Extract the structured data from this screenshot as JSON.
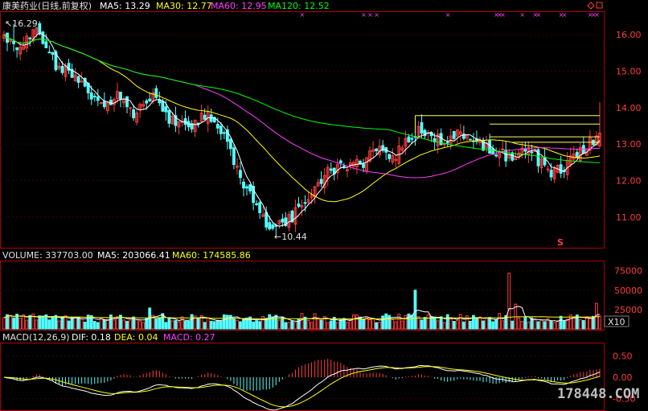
{
  "header": {
    "stock_title": "康美药业(日线,前复权)",
    "ma5_label": "MA5: 13.29",
    "ma30_label": "MA30: 12.77",
    "ma60_label": "MA60: 12.95",
    "ma120_label": "MA120: 12.52"
  },
  "volume_header": {
    "volume_label": "VOLUME: 337703.00",
    "ma5_label": "MA5: 203066.41",
    "ma60_label": "MA60: 174585.86"
  },
  "macd_header": {
    "name_label": "MACD(12,26,9)",
    "dif_label": "DIF: 0.18",
    "dea_label": "DEA: 0.04",
    "macd_label": "MACD: 0.27"
  },
  "annotations": {
    "high_label": "16.29",
    "low_label": "10.44",
    "s_marker": "S",
    "volume_unit": "X10"
  },
  "watermark": "178448.COM",
  "colors": {
    "background": "#000000",
    "frame": "#b00000",
    "up": "#ff3c3c",
    "down": "#54ffff",
    "ma5": "#ffffff",
    "ma30": "#ffff00",
    "ma60": "#ff3cff",
    "ma120": "#00ff00",
    "axis_text": "#ff3c3c",
    "header_text": "#e0e0e0"
  },
  "chart_data": [
    {
      "type": "candlestick",
      "title": "康美药业(日线,前复权)",
      "ylim": [
        10.2,
        16.6
      ],
      "yticks": [
        11.0,
        12.0,
        13.0,
        14.0,
        15.0,
        16.0
      ],
      "high": 16.29,
      "low": 10.44,
      "anchors": [
        [
          0,
          16.0
        ],
        [
          5,
          15.7
        ],
        [
          10,
          16.1
        ],
        [
          16,
          15.2
        ],
        [
          22,
          14.8
        ],
        [
          30,
          14.1
        ],
        [
          36,
          14.4
        ],
        [
          40,
          13.8
        ],
        [
          46,
          14.3
        ],
        [
          52,
          13.6
        ],
        [
          58,
          13.4
        ],
        [
          62,
          13.8
        ],
        [
          66,
          13.5
        ],
        [
          70,
          12.8
        ],
        [
          74,
          11.9
        ],
        [
          78,
          11.4
        ],
        [
          82,
          10.7
        ],
        [
          85,
          11.0
        ],
        [
          88,
          10.9
        ],
        [
          92,
          11.4
        ],
        [
          96,
          11.8
        ],
        [
          100,
          12.2
        ],
        [
          104,
          12.5
        ],
        [
          110,
          12.4
        ],
        [
          116,
          12.9
        ],
        [
          120,
          12.6
        ],
        [
          124,
          13.0
        ],
        [
          128,
          13.4
        ],
        [
          132,
          13.2
        ],
        [
          136,
          13.1
        ],
        [
          140,
          13.4
        ],
        [
          144,
          13.2
        ],
        [
          148,
          12.9
        ],
        [
          152,
          12.8
        ],
        [
          156,
          12.6
        ],
        [
          160,
          12.9
        ],
        [
          164,
          12.7
        ],
        [
          168,
          12.2
        ],
        [
          172,
          12.3
        ],
        [
          176,
          12.7
        ],
        [
          180,
          12.9
        ],
        [
          184,
          13.3
        ]
      ],
      "series": [
        {
          "name": "MA5",
          "value": 13.29
        },
        {
          "name": "MA30",
          "value": 12.77
        },
        {
          "name": "MA60",
          "value": 12.95
        },
        {
          "name": "MA120",
          "value": 12.52
        }
      ]
    },
    {
      "type": "bar",
      "title": "VOLUME",
      "ylim": [
        0,
        85000
      ],
      "yticks": [
        25000,
        50000,
        75000
      ],
      "volume_last": 337703.0,
      "series": [
        {
          "name": "MA5",
          "value": 203066.41
        },
        {
          "name": "MA60",
          "value": 174585.86
        }
      ],
      "spikes": [
        [
          45,
          27000
        ],
        [
          127,
          50000
        ],
        [
          156,
          72000
        ],
        [
          158,
          32000
        ],
        [
          183,
          33000
        ]
      ]
    },
    {
      "type": "bar",
      "title": "MACD(12,26,9)",
      "ylim": [
        -0.75,
        0.75
      ],
      "yticks": [
        -0.5,
        0.0,
        0.5
      ],
      "series": [
        {
          "name": "DIF",
          "value": 0.18
        },
        {
          "name": "DEA",
          "value": 0.04
        },
        {
          "name": "MACD",
          "value": 0.27
        }
      ]
    }
  ]
}
